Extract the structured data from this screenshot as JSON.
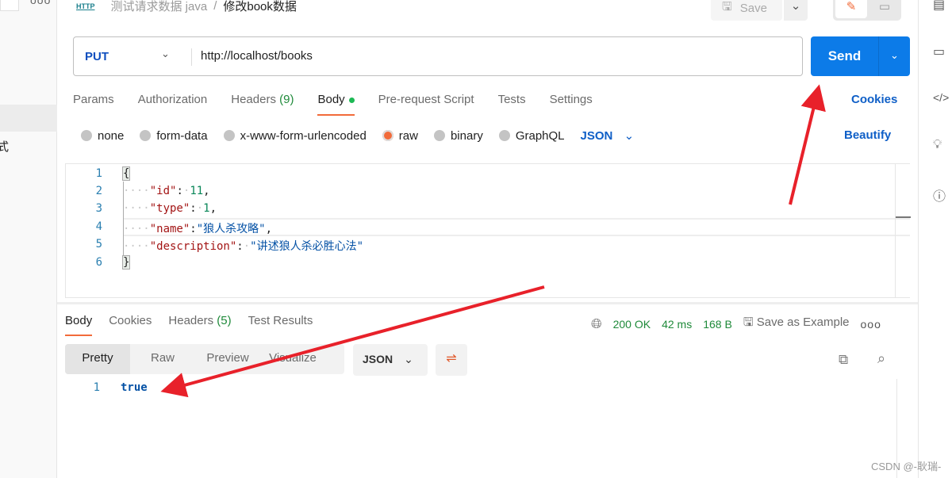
{
  "sidebar": {
    "partial_text": "式",
    "more_icon": "more-icon"
  },
  "breadcrumb": {
    "collection": "测试请求数据 java",
    "separator": "/",
    "request": "修改book数据",
    "type_badge": "HTTP"
  },
  "toolbar": {
    "save_label": "Save"
  },
  "request": {
    "method": "PUT",
    "url": "http://localhost/books",
    "send_label": "Send"
  },
  "tabs": [
    {
      "label": "Params"
    },
    {
      "label": "Authorization"
    },
    {
      "label": "Headers",
      "count": "(9)"
    },
    {
      "label": "Body",
      "active": true
    },
    {
      "label": "Pre-request Script"
    },
    {
      "label": "Tests"
    },
    {
      "label": "Settings"
    }
  ],
  "cookies_label": "Cookies",
  "body_types": [
    {
      "label": "none"
    },
    {
      "label": "form-data"
    },
    {
      "label": "x-www-form-urlencoded"
    },
    {
      "label": "raw",
      "selected": true
    },
    {
      "label": "binary"
    },
    {
      "label": "GraphQL"
    }
  ],
  "body_format": "JSON",
  "beautify_label": "Beautify",
  "editor": {
    "line_numbers": [
      "1",
      "2",
      "3",
      "4",
      "5",
      "6"
    ],
    "open": "{",
    "close": "}",
    "lines": [
      {
        "key": "\"id\"",
        "value": "11",
        "trail": ","
      },
      {
        "key": "\"type\"",
        "value": "1",
        "trail": ","
      },
      {
        "key": "\"name\"",
        "value": "\"狼人杀攻略\"",
        "trail": ","
      },
      {
        "key": "\"description\"",
        "value": "\"讲述狼人杀必胜心法\"",
        "trail": ""
      }
    ]
  },
  "response": {
    "tabs": [
      {
        "label": "Body",
        "active": true
      },
      {
        "label": "Cookies"
      },
      {
        "label": "Headers",
        "count": "(5)"
      },
      {
        "label": "Test Results"
      }
    ],
    "status": "200 OK",
    "time": "42 ms",
    "size": "168 B",
    "save_example": "Save as Example",
    "views": [
      "Pretty",
      "Raw",
      "Preview",
      "Visualize"
    ],
    "format": "JSON",
    "line_number": "1",
    "value": "true"
  },
  "watermark": "CSDN @-耿瑞-",
  "colors": {
    "accent": "#f26b3a",
    "send": "#0c7be8",
    "link": "#0f5fc7",
    "status_ok": "#1f8a3a",
    "annotation_arrow": "#e8212a"
  }
}
